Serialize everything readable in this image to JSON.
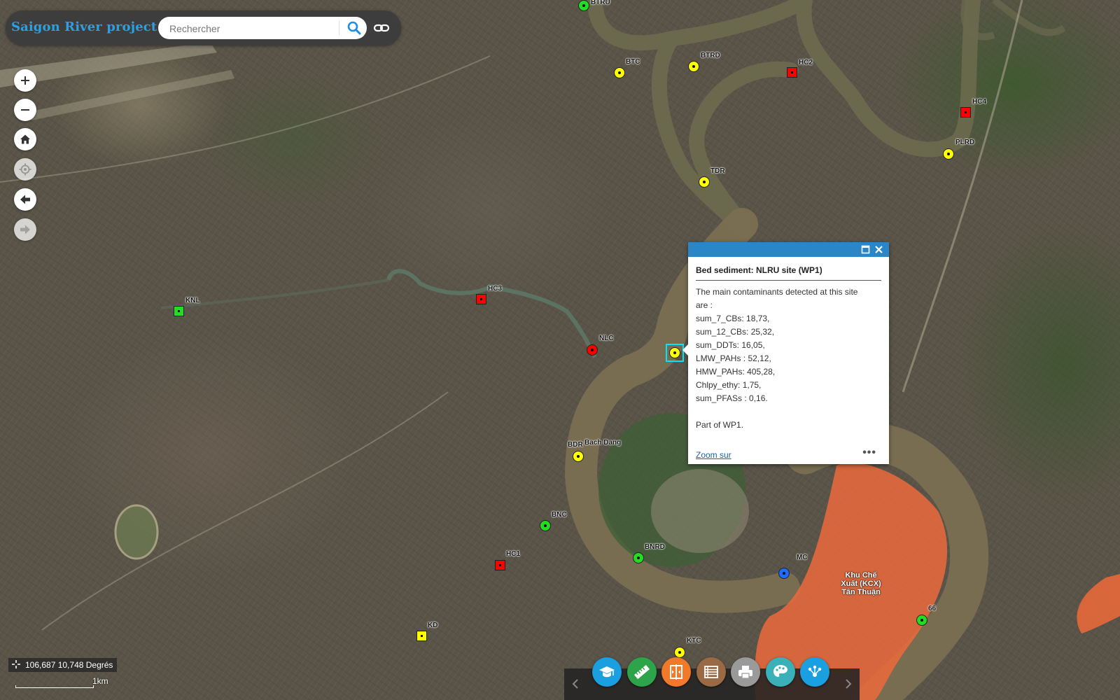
{
  "app": {
    "title": "Saigon River project"
  },
  "search": {
    "placeholder": "Rechercher"
  },
  "nav": {
    "zoom_in": "+",
    "zoom_out": "−"
  },
  "sites": [
    {
      "label": "BTRU",
      "color": "#22dd22",
      "shape": "circle"
    },
    {
      "label": "BTC",
      "color": "#ffff00",
      "shape": "circle"
    },
    {
      "label": "BTRD",
      "color": "#ffff00",
      "shape": "circle"
    },
    {
      "label": "HC2",
      "color": "#ff0000",
      "shape": "square"
    },
    {
      "label": "HC4",
      "color": "#ff0000",
      "shape": "square"
    },
    {
      "label": "PLRD",
      "color": "#ffff00",
      "shape": "circle"
    },
    {
      "label": "TDR",
      "color": "#ffff00",
      "shape": "circle"
    },
    {
      "label": "KNL",
      "color": "#22dd22",
      "shape": "square"
    },
    {
      "label": "HC3",
      "color": "#ff0000",
      "shape": "square"
    },
    {
      "label": "NLC",
      "color": "#ff0000",
      "shape": "circle"
    },
    {
      "label": "BDR",
      "color": "#ffff00",
      "shape": "circle"
    },
    {
      "label": "Bach Dang",
      "color": "",
      "shape": "label"
    },
    {
      "label": "BNC",
      "color": "#22dd22",
      "shape": "circle"
    },
    {
      "label": "HC1",
      "color": "#ff0000",
      "shape": "square"
    },
    {
      "label": "BNRD",
      "color": "#22dd22",
      "shape": "circle"
    },
    {
      "label": "MC",
      "color": "#1e6cff",
      "shape": "circle"
    },
    {
      "label": "KD",
      "color": "#ffff00",
      "shape": "square"
    },
    {
      "label": "KTC",
      "color": "#ffff00",
      "shape": "circle"
    },
    {
      "label": "66",
      "color": "#22dd22",
      "shape": "circle"
    },
    {
      "label": "",
      "color": "#ffff00",
      "shape": "circle"
    }
  ],
  "zone": {
    "label_lines": [
      "Khu Chế",
      "Xuất (KCX)",
      "Tân Thuận"
    ],
    "color": "#f06a3a"
  },
  "popup": {
    "title": "Bed sediment: NLRU site (WP1)",
    "intro_1": "The main contaminants detected at this site",
    "intro_2": "are :",
    "lines": [
      "sum_7_CBs: 18,73,",
      "sum_12_CBs: 25,32,",
      "sum_DDTs: 16,05,",
      "LMW_PAHs : 52,12,",
      "HMW_PAHs: 405,28,",
      "Chlpy_ethy: 1,75,",
      "sum_PFASs : 0,16."
    ],
    "footer": "Part of WP1.",
    "zoom_link": "Zoom sur",
    "more": "•••",
    "header_color": "#2b86c8"
  },
  "coordinates": {
    "text": "106,687 10,748 Degrés"
  },
  "scale": {
    "label": "1km"
  },
  "toolbar": {
    "tools": [
      {
        "name": "legend-tool",
        "color": "#1aa0e0"
      },
      {
        "name": "measure-tool",
        "color": "#2ea44a"
      },
      {
        "name": "swipe-tool",
        "color": "#f07a2a"
      },
      {
        "name": "layer-list-tool",
        "color": "#9a6a45"
      },
      {
        "name": "print-tool",
        "color": "#9a9a9a"
      },
      {
        "name": "basemap-tool",
        "color": "#3ab0b8"
      },
      {
        "name": "share-tool",
        "color": "#1aa0e0"
      }
    ]
  }
}
